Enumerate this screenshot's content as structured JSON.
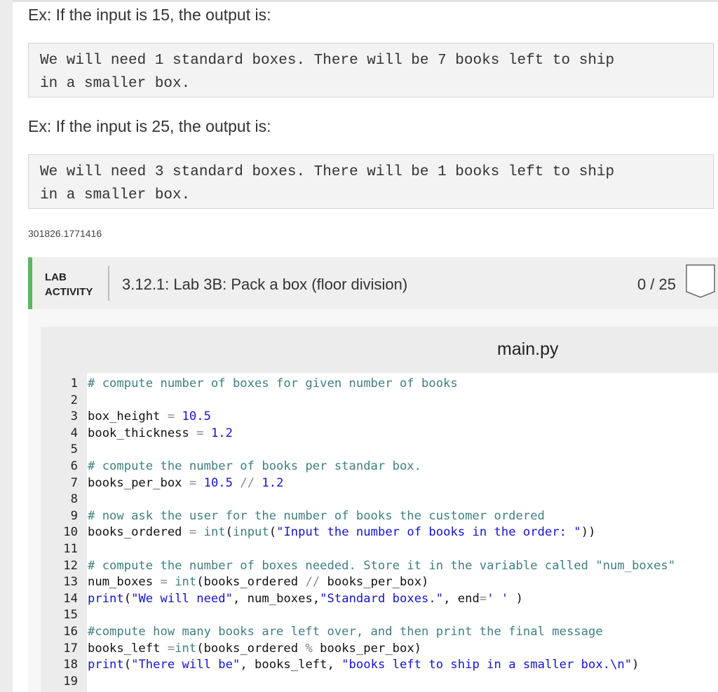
{
  "examples": [
    {
      "label": "Ex: If the input is 15, the output is:",
      "output_lines": [
        "We will need 1 standard boxes. There will be 7 books left to ship",
        "in a smaller box."
      ]
    },
    {
      "label": "Ex: If the input is 25, the output is:",
      "output_lines": [
        "We will need 3 standard boxes. There will be 1 books left to ship",
        "in a smaller box."
      ]
    }
  ],
  "lab_id": "301826.1771416",
  "lab": {
    "tag_line1": "LAB",
    "tag_line2": "ACTIVITY",
    "title": "3.12.1: Lab 3B: Pack a box (floor division)",
    "score": "0 / 25",
    "accent_color": "#5cb85c"
  },
  "editor": {
    "file_name": "main.py",
    "lines": [
      {
        "n": "1",
        "tokens": [
          {
            "t": "# compute number of boxes for given number of books",
            "c": "cm"
          }
        ]
      },
      {
        "n": "2",
        "tokens": []
      },
      {
        "n": "3",
        "tokens": [
          {
            "t": "box_height ",
            "c": ""
          },
          {
            "t": "=",
            "c": "op"
          },
          {
            "t": " ",
            "c": ""
          },
          {
            "t": "10.5",
            "c": "nm"
          }
        ]
      },
      {
        "n": "4",
        "tokens": [
          {
            "t": "book_thickness ",
            "c": ""
          },
          {
            "t": "=",
            "c": "op"
          },
          {
            "t": " ",
            "c": ""
          },
          {
            "t": "1.2",
            "c": "nm"
          }
        ]
      },
      {
        "n": "5",
        "tokens": []
      },
      {
        "n": "6",
        "tokens": [
          {
            "t": "# compute the number of books per standar box.",
            "c": "cm"
          }
        ]
      },
      {
        "n": "7",
        "tokens": [
          {
            "t": "books_per_box ",
            "c": ""
          },
          {
            "t": "=",
            "c": "op"
          },
          {
            "t": " ",
            "c": ""
          },
          {
            "t": "10.5",
            "c": "nm"
          },
          {
            "t": " ",
            "c": ""
          },
          {
            "t": "//",
            "c": "op"
          },
          {
            "t": " ",
            "c": ""
          },
          {
            "t": "1.2",
            "c": "nm"
          }
        ]
      },
      {
        "n": "8",
        "tokens": []
      },
      {
        "n": "9",
        "tokens": [
          {
            "t": "# now ask the user for the number of books the customer ordered",
            "c": "cm"
          }
        ]
      },
      {
        "n": "10",
        "tokens": [
          {
            "t": "books_ordered ",
            "c": ""
          },
          {
            "t": "=",
            "c": "op"
          },
          {
            "t": " ",
            "c": ""
          },
          {
            "t": "int",
            "c": "bi"
          },
          {
            "t": "(",
            "c": ""
          },
          {
            "t": "input",
            "c": "bi"
          },
          {
            "t": "(",
            "c": ""
          },
          {
            "t": "\"Input the number of books in the order: \"",
            "c": "st"
          },
          {
            "t": "))",
            "c": ""
          }
        ]
      },
      {
        "n": "11",
        "tokens": []
      },
      {
        "n": "12",
        "tokens": [
          {
            "t": "# compute the number of boxes needed. Store it in the variable called \"num_boxes\"",
            "c": "cm"
          }
        ]
      },
      {
        "n": "13",
        "tokens": [
          {
            "t": "num_boxes ",
            "c": ""
          },
          {
            "t": "=",
            "c": "op"
          },
          {
            "t": " ",
            "c": ""
          },
          {
            "t": "int",
            "c": "bi"
          },
          {
            "t": "(books_ordered ",
            "c": ""
          },
          {
            "t": "//",
            "c": "op"
          },
          {
            "t": " books_per_box)",
            "c": ""
          }
        ]
      },
      {
        "n": "14",
        "tokens": [
          {
            "t": "print",
            "c": "kw"
          },
          {
            "t": "(",
            "c": ""
          },
          {
            "t": "\"We will need\"",
            "c": "st"
          },
          {
            "t": ", num_boxes,",
            "c": ""
          },
          {
            "t": "\"Standard boxes.\"",
            "c": "st"
          },
          {
            "t": ", end",
            "c": ""
          },
          {
            "t": "=",
            "c": "op"
          },
          {
            "t": "' '",
            "c": "st"
          },
          {
            "t": " )",
            "c": ""
          }
        ]
      },
      {
        "n": "15",
        "tokens": []
      },
      {
        "n": "16",
        "tokens": [
          {
            "t": "#compute how many books are left over, and then print the final message",
            "c": "cm"
          }
        ]
      },
      {
        "n": "17",
        "tokens": [
          {
            "t": "books_left ",
            "c": ""
          },
          {
            "t": "=",
            "c": "op"
          },
          {
            "t": "int",
            "c": "bi"
          },
          {
            "t": "(books_ordered ",
            "c": ""
          },
          {
            "t": "%",
            "c": "op"
          },
          {
            "t": " books_per_box)",
            "c": ""
          }
        ]
      },
      {
        "n": "18",
        "tokens": [
          {
            "t": "print",
            "c": "kw"
          },
          {
            "t": "(",
            "c": ""
          },
          {
            "t": "\"There will be\"",
            "c": "st"
          },
          {
            "t": ", books_left, ",
            "c": ""
          },
          {
            "t": "\"books left to ship in a smaller box.\\n\"",
            "c": "st"
          },
          {
            "t": ")",
            "c": ""
          }
        ]
      },
      {
        "n": "19",
        "tokens": []
      }
    ]
  }
}
